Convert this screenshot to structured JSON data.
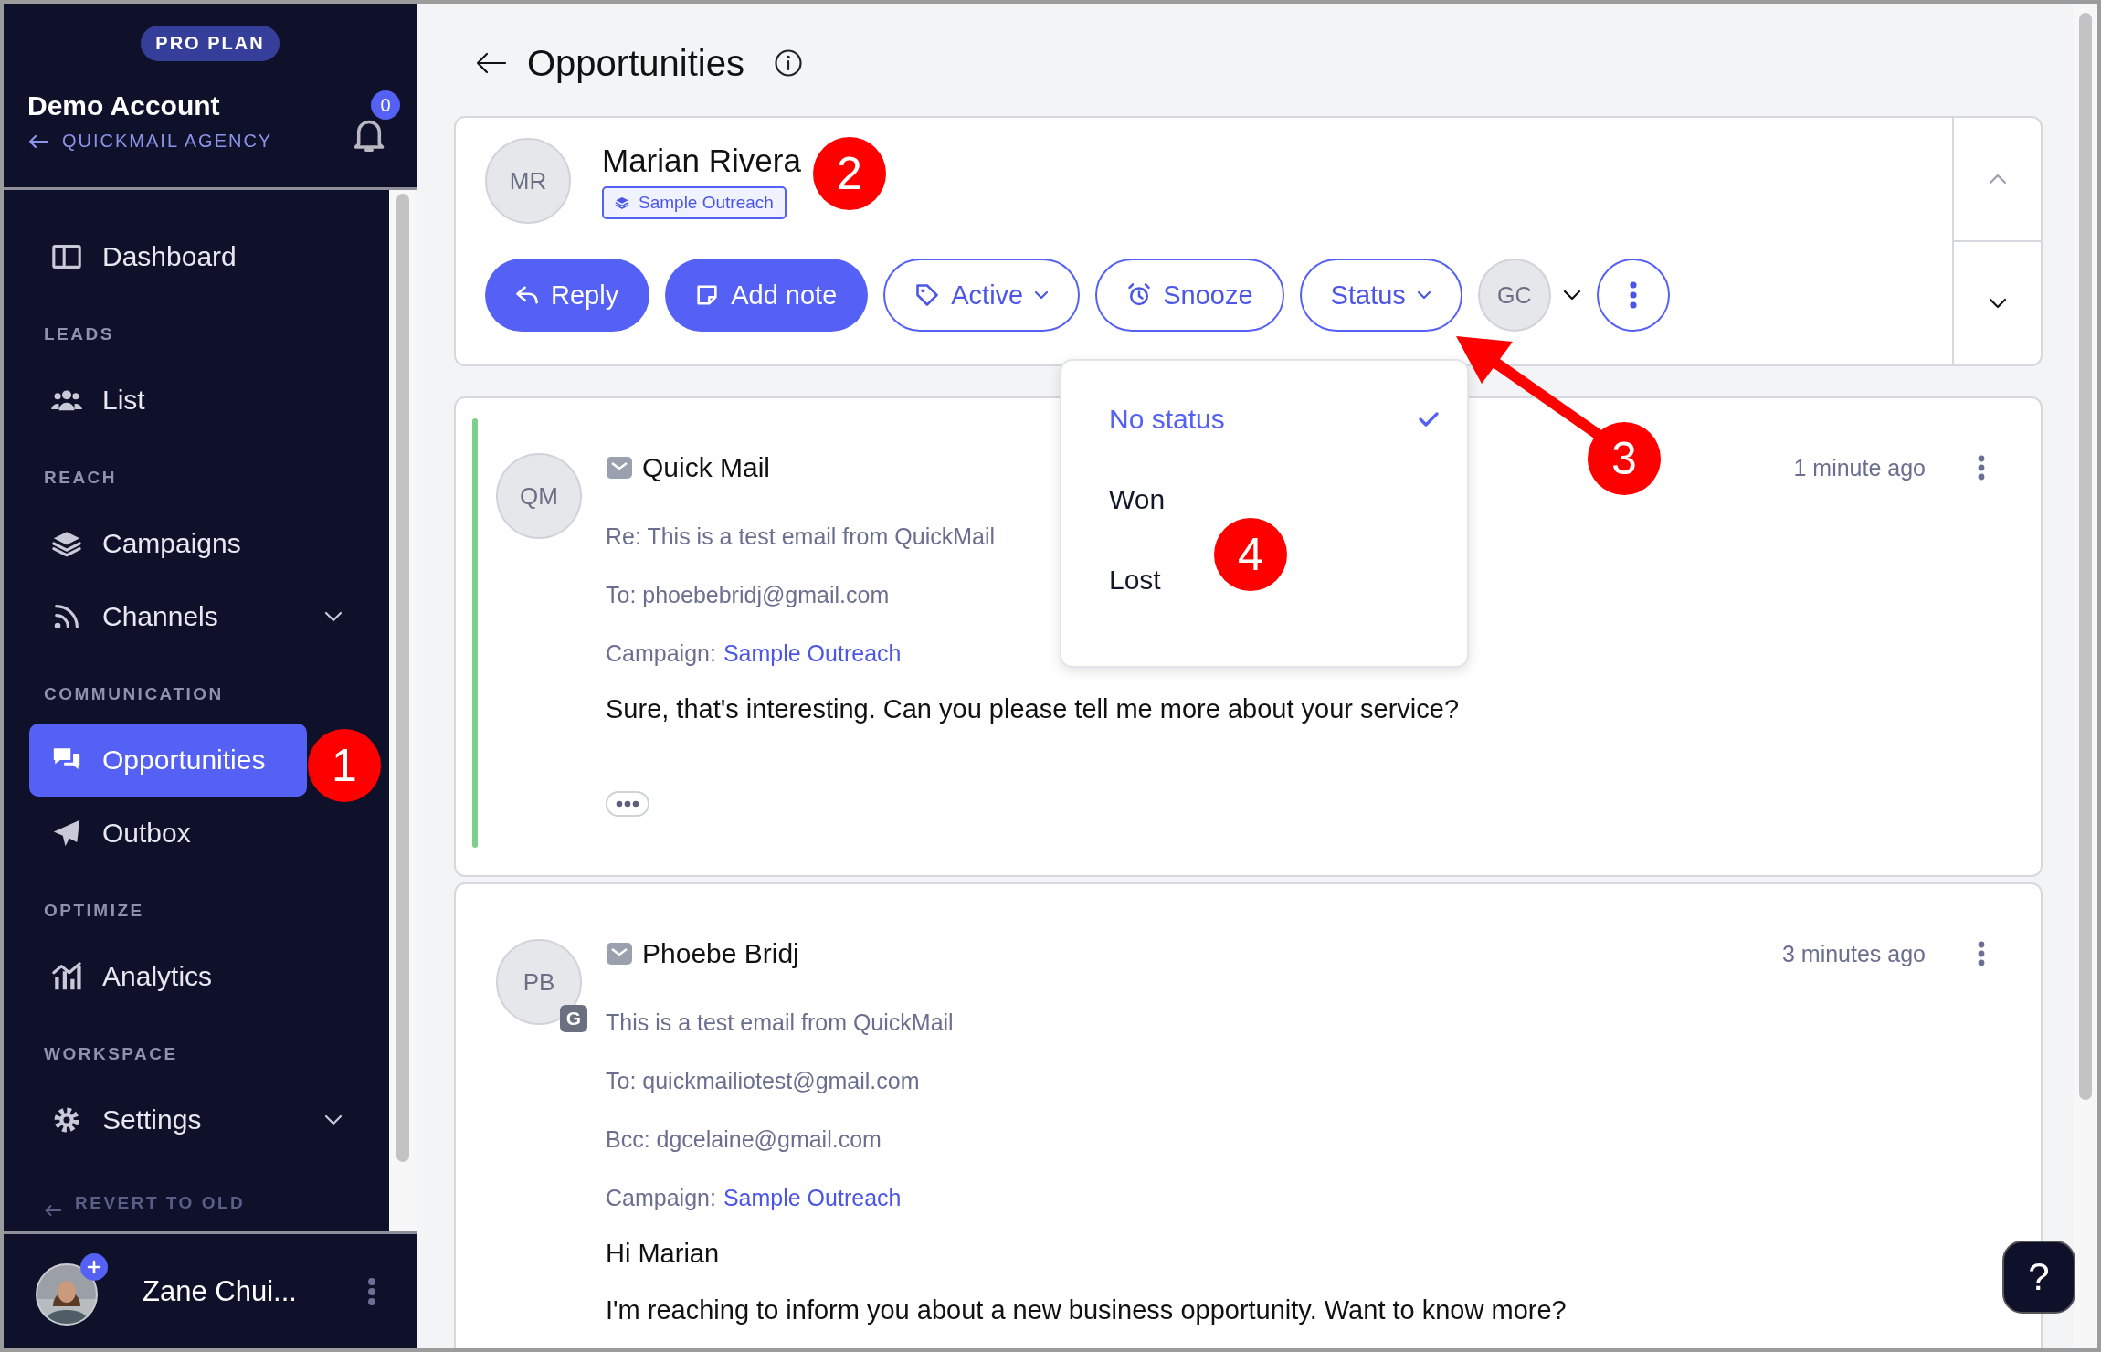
{
  "plan_badge": "PRO PLAN",
  "account": {
    "name": "Demo Account",
    "agency": "QUICKMAIL AGENCY",
    "notifications": "0"
  },
  "nav": [
    {
      "kind": "item",
      "label": "Dashboard",
      "selected": false
    },
    {
      "kind": "section",
      "label": "LEADS"
    },
    {
      "kind": "item",
      "label": "List",
      "selected": false
    },
    {
      "kind": "section",
      "label": "REACH"
    },
    {
      "kind": "item",
      "label": "Campaigns",
      "selected": false
    },
    {
      "kind": "group",
      "label": "Channels",
      "selected": false,
      "expanded": false
    },
    {
      "kind": "section",
      "label": "COMMUNICATION"
    },
    {
      "kind": "item",
      "label": "Opportunities",
      "selected": true
    },
    {
      "kind": "item",
      "label": "Outbox",
      "selected": false
    },
    {
      "kind": "section",
      "label": "OPTIMIZE"
    },
    {
      "kind": "item",
      "label": "Analytics",
      "selected": false
    },
    {
      "kind": "section",
      "label": "WORKSPACE"
    },
    {
      "kind": "group",
      "label": "Settings",
      "selected": false,
      "expanded": false
    }
  ],
  "revert_link": "REVERT TO OLD",
  "user": {
    "name": "Zane Chui..."
  },
  "page_title": "Opportunities",
  "lead": {
    "initials": "MR",
    "name": "Marian Rivera",
    "campaign": "Sample Outreach",
    "actions": [
      {
        "kind": "primary",
        "label": "Reply"
      },
      {
        "kind": "primary",
        "label": "Add note"
      },
      {
        "kind": "dropdown",
        "label": "Active"
      },
      {
        "kind": "outline",
        "label": "Snooze"
      },
      {
        "kind": "dropdown",
        "label": "Status"
      }
    ],
    "assignee": "GC"
  },
  "status_menu": [
    {
      "label": "No status",
      "selected": true
    },
    {
      "label": "Won",
      "selected": false
    },
    {
      "label": "Lost",
      "selected": false
    }
  ],
  "messages": [
    {
      "sender": "Quick Mail",
      "initials": "QM",
      "highlighted": true,
      "time": "1 minute ago",
      "fields": [
        {
          "kind": "plain",
          "text": "Re: This is a test email from QuickMail"
        },
        {
          "kind": "plain",
          "text": "To: phoebebridj@gmail.com"
        },
        {
          "kind": "link",
          "label": "Campaign:",
          "text": "Sample Outreach"
        }
      ],
      "body": [
        "Sure, that's interesting. Can you please tell me more about your service?"
      ],
      "collapsed": true
    },
    {
      "sender": "Phoebe Bridj",
      "initials": "PB",
      "badge": "G",
      "highlighted": false,
      "time": "3 minutes ago",
      "fields": [
        {
          "kind": "plain",
          "text": "This is a test email from QuickMail"
        },
        {
          "kind": "plain",
          "text": "To: quickmailiotest@gmail.com"
        },
        {
          "kind": "plain",
          "text": "Bcc: dgcelaine@gmail.com"
        },
        {
          "kind": "link",
          "label": "Campaign:",
          "text": "Sample Outreach"
        }
      ],
      "body": [
        "Hi Marian",
        "I'm reaching to inform you about a new business opportunity. Want to know more?"
      ],
      "collapsed": false
    }
  ],
  "help": "?",
  "annotations": [
    {
      "label": "1"
    },
    {
      "label": "2"
    },
    {
      "label": "3"
    },
    {
      "label": "4"
    }
  ]
}
